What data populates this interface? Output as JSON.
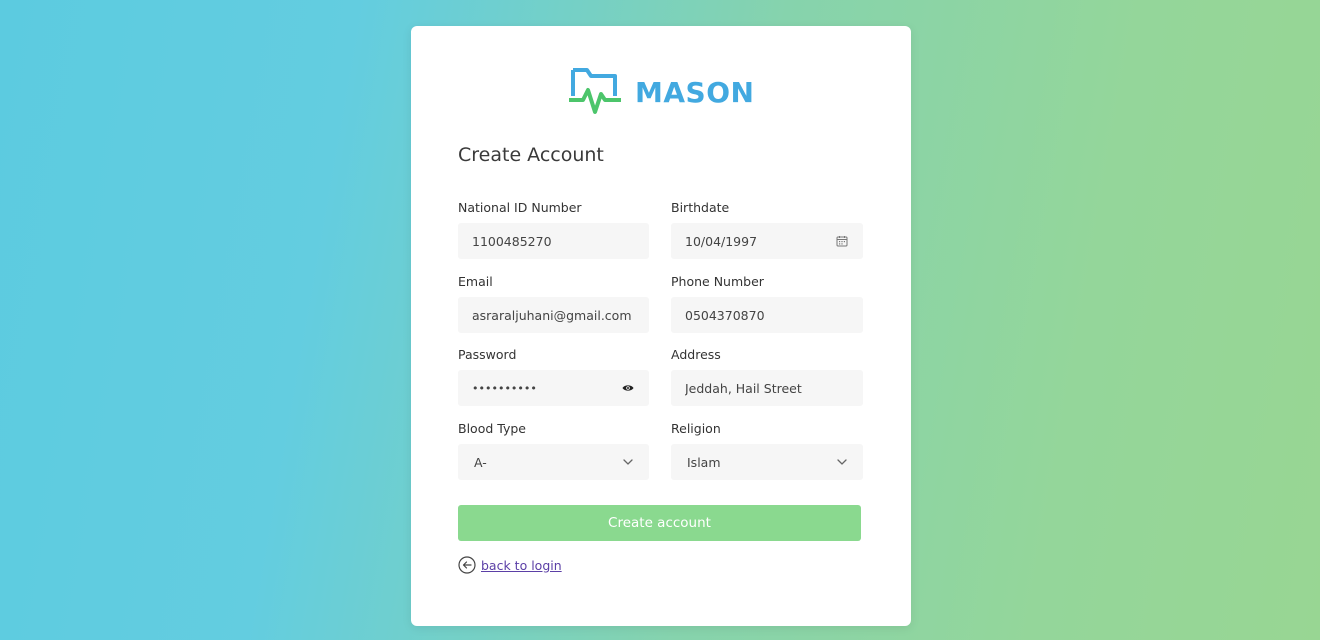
{
  "brand": {
    "name": "MASON",
    "colors": {
      "blue": "#42a9e0",
      "green": "#4cc56b"
    }
  },
  "form": {
    "title": "Create Account",
    "national_id": {
      "label": "National ID Number",
      "value": "1100485270"
    },
    "birthdate": {
      "label": "Birthdate",
      "value": "10/04/1997",
      "icon": "calendar-icon"
    },
    "email": {
      "label": "Email",
      "value": "asraraljuhani@gmail.com"
    },
    "phone": {
      "label": "Phone Number",
      "value": "0504370870"
    },
    "password": {
      "label": "Password",
      "value": "••••••••••",
      "icon": "eye-icon"
    },
    "address": {
      "label": "Address",
      "value": "Jeddah, Hail Street"
    },
    "blood_type": {
      "label": "Blood Type",
      "value": "A-",
      "icon": "chevron-down-icon"
    },
    "religion": {
      "label": "Religion",
      "value": "Islam",
      "icon": "chevron-down-icon"
    },
    "submit_label": "Create account",
    "back_label": "back to login"
  },
  "colors": {
    "button": "#8ad98f",
    "link": "#5b3fa6",
    "input_bg": "#f6f6f6"
  }
}
